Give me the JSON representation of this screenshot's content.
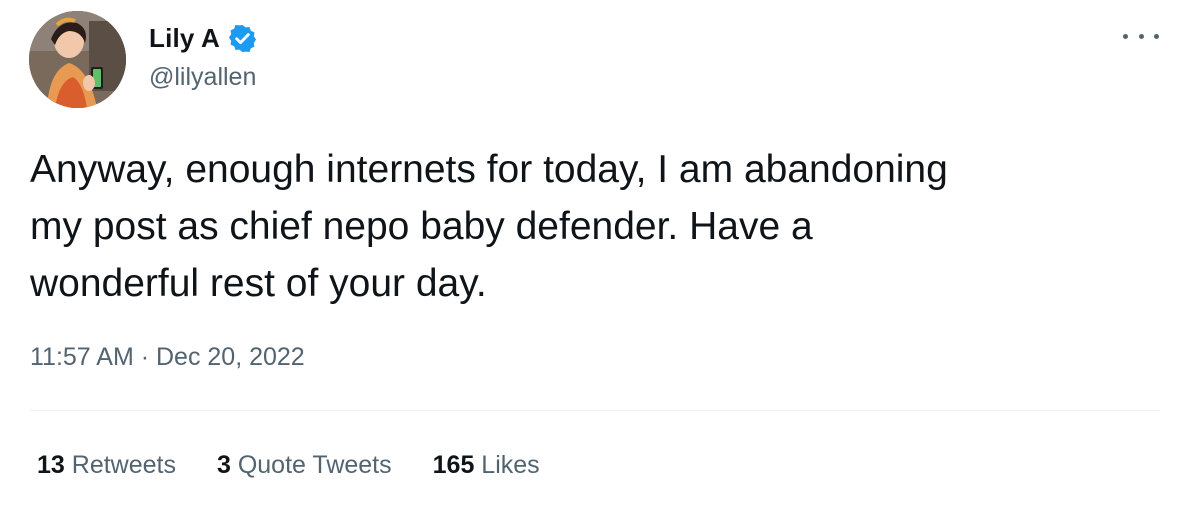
{
  "user": {
    "display_name": "Lily A",
    "handle": "@lilyallen",
    "verified": true
  },
  "tweet": {
    "text": "Anyway, enough internets for today, I am abandoning\nmy post as chief nepo baby defender. Have a\nwonderful rest of your day.",
    "timestamp": "11:57 AM · Dec 20, 2022"
  },
  "stats": {
    "retweets_count": "13",
    "retweets_label": " Retweets",
    "quotes_count": "3",
    "quotes_label": " Quote Tweets",
    "likes_count": "165",
    "likes_label": " Likes"
  },
  "icons": {
    "verified": "verified-badge-icon",
    "more": "more-options-icon"
  },
  "colors": {
    "text_primary": "#0f1419",
    "text_secondary": "#536471",
    "verified_blue": "#1d9bf0",
    "divider": "#eff3f4"
  }
}
